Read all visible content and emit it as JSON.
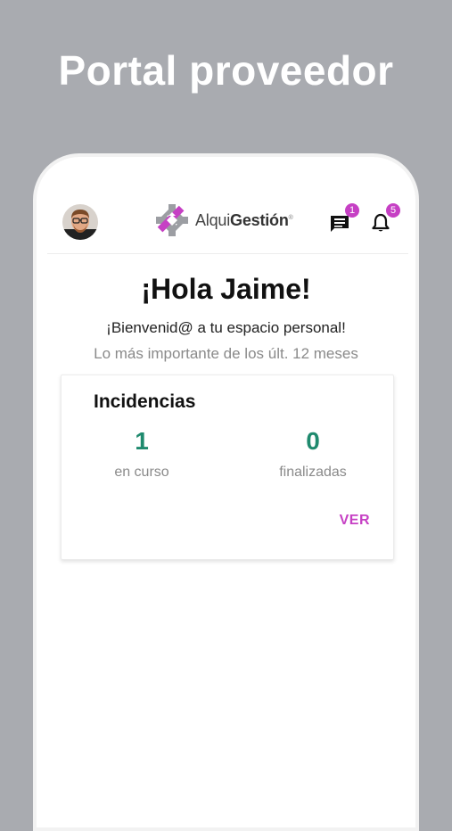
{
  "hero": {
    "title": "Portal proveedor"
  },
  "header": {
    "logo": {
      "prefix": "Alqui",
      "bold": "Gestión",
      "mark": "®"
    },
    "messages": {
      "icon": "chat-icon",
      "count": "1"
    },
    "notifications": {
      "icon": "bell-icon",
      "count": "5"
    }
  },
  "main": {
    "greeting": "¡Hola Jaime!",
    "welcome": "¡Bienvenid@ a tu espacio personal!",
    "period": "Lo más importante de los últ. 12 meses"
  },
  "incidencias": {
    "title": "Incidencias",
    "in_progress": {
      "value": "1",
      "label": "en curso"
    },
    "finished": {
      "value": "0",
      "label": "finalizadas"
    },
    "view_label": "VER"
  },
  "colors": {
    "accent": "#c640c4",
    "stat": "#1f8a6e",
    "background": "#a9abb0"
  }
}
